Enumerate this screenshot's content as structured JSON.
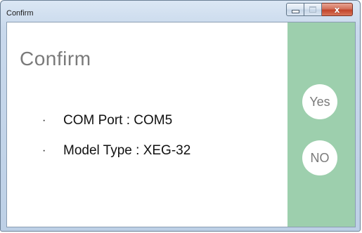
{
  "window": {
    "title": "Confirm"
  },
  "caption": {
    "minimize_glyph": "minimize-icon",
    "maximize_glyph": "maximize-icon",
    "close_glyph": "x"
  },
  "dialog": {
    "heading": "Confirm",
    "bullet": "·",
    "items": [
      {
        "label": "COM Port : COM5"
      },
      {
        "label": "Model Type : XEG-32"
      }
    ]
  },
  "actions": {
    "yes_label": "Yes",
    "no_label": "NO"
  },
  "colors": {
    "panel": "#9dcfad",
    "heading_text": "#7a7a7a",
    "close_button": "#c2452b"
  }
}
